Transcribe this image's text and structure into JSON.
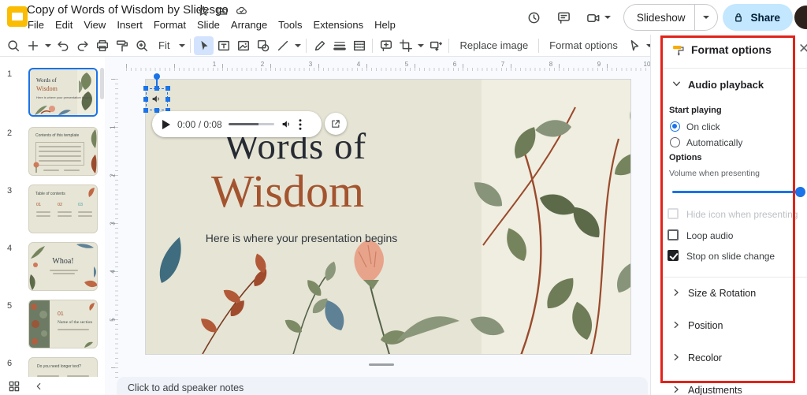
{
  "header": {
    "title": "Copy of Words of Wisdom by Slidesgo",
    "menus": [
      "File",
      "Edit",
      "View",
      "Insert",
      "Format",
      "Slide",
      "Arrange",
      "Tools",
      "Extensions",
      "Help"
    ],
    "slideshow": "Slideshow",
    "share": "Share"
  },
  "toolbar": {
    "fit": "Fit",
    "replace_image": "Replace image",
    "format_options": "Format options"
  },
  "filmstrip": {
    "slides": [
      {
        "num": "1",
        "line1": "Words of",
        "line2": "Wisdom",
        "sub": "Here is where your presentation begins"
      },
      {
        "num": "2",
        "title": "Contents of this template"
      },
      {
        "num": "3",
        "title": "Table of contents",
        "i1": "01",
        "i2": "02",
        "i3": "03"
      },
      {
        "num": "4",
        "title": "Whoa!"
      },
      {
        "num": "5",
        "index": "01",
        "title": "Name of the section"
      },
      {
        "num": "6",
        "title": "Do you need longer text?"
      }
    ]
  },
  "rulers": {
    "h": [
      "1",
      "2",
      "3",
      "4",
      "5",
      "6",
      "7",
      "8",
      "9",
      "10"
    ],
    "v": [
      "1",
      "2",
      "3",
      "4",
      "5"
    ]
  },
  "slide": {
    "title1": "Words of",
    "title2": "Wisdom",
    "subtitle": "Here is where your presentation begins"
  },
  "player": {
    "time": "0:00 / 0:08"
  },
  "notes": {
    "placeholder": "Click to add speaker notes"
  },
  "panel": {
    "title": "Format options",
    "audio_playback": "Audio playback",
    "start_playing": "Start playing",
    "on_click": "On click",
    "automatically": "Automatically",
    "options": "Options",
    "volume_label": "Volume when presenting",
    "hide_icon": "Hide icon when presenting",
    "loop_audio": "Loop audio",
    "stop_on_change": "Stop on slide change",
    "sections": [
      "Size & Rotation",
      "Position",
      "Recolor",
      "Adjustments"
    ]
  },
  "colors": {
    "accent": "#1a73e8",
    "share_bg": "#c2e7ff",
    "annotation_red": "#e2231a",
    "title_rust": "#a3542f",
    "slide_bg": "#e6e4d4",
    "leaf_bg": "#efeee0"
  }
}
